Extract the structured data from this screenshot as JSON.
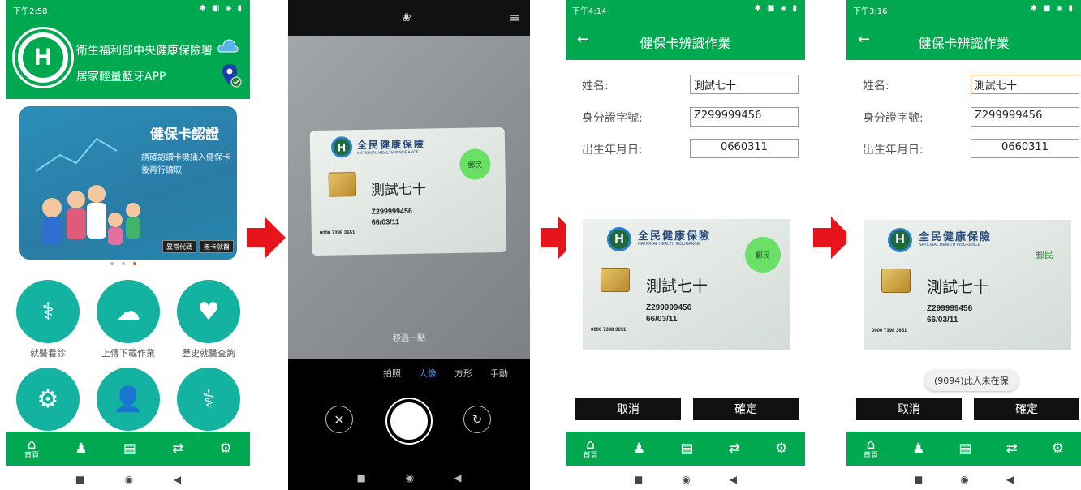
{
  "colors": {
    "brand_green": "#00a94f",
    "tile_teal": "#14b2a0",
    "arrow_red": "#e8141b",
    "banner_blue": "#2a7ca6"
  },
  "phone1": {
    "status_time": "下午2:58",
    "org_name": "衛生福利部中央健康保險署",
    "app_name": "居家輕量藍牙APP",
    "banner": {
      "title": "健保卡認證",
      "subtitle": "請確認讀卡機插入健保卡後再行讀取",
      "btn1": "異常代碼",
      "btn2": "無卡就醫"
    },
    "tiles": [
      {
        "label": "就醫看診",
        "icon": "doctor-visit-icon"
      },
      {
        "label": "上傳下載作業",
        "icon": "cloud-sync-icon"
      },
      {
        "label": "歷史就醫查詢",
        "icon": "medical-history-icon"
      },
      {
        "label": "",
        "icon": "settings-gears-icon"
      },
      {
        "label": "",
        "icon": "staff-icon"
      },
      {
        "label": "",
        "icon": "consultation-icon"
      }
    ]
  },
  "nav": {
    "home_label": "首頁"
  },
  "phone2": {
    "hint": "移過一點",
    "modes": [
      "拍照",
      "人像",
      "方形",
      "手動"
    ],
    "active_mode": "人像"
  },
  "card": {
    "title": "全民健康保險",
    "subtitle": "NATIONAL HEALTH INSURANCE",
    "name": "測試七十",
    "id": "Z299999456",
    "dob": "66/03/11",
    "card_no": "0000 7398 3651",
    "stamp": "郵民"
  },
  "phone3": {
    "status_time": "下午4:14",
    "title": "健保卡辨識作業",
    "labels": {
      "name": "姓名:",
      "id": "身分證字號:",
      "dob": "出生年月日:"
    },
    "values": {
      "name": "測試七十",
      "id": "Z299999456",
      "dob": "0660311"
    },
    "cancel": "取消",
    "confirm": "確定"
  },
  "phone4": {
    "status_time": "下午3:16",
    "title": "健保卡辨識作業",
    "labels": {
      "name": "姓名:",
      "id": "身分證字號:",
      "dob": "出生年月日:"
    },
    "values": {
      "name": "測試七十",
      "id": "Z299999456",
      "dob": "0660311"
    },
    "toast": "(9094)此人未在保",
    "cancel": "取消",
    "confirm": "確定"
  }
}
